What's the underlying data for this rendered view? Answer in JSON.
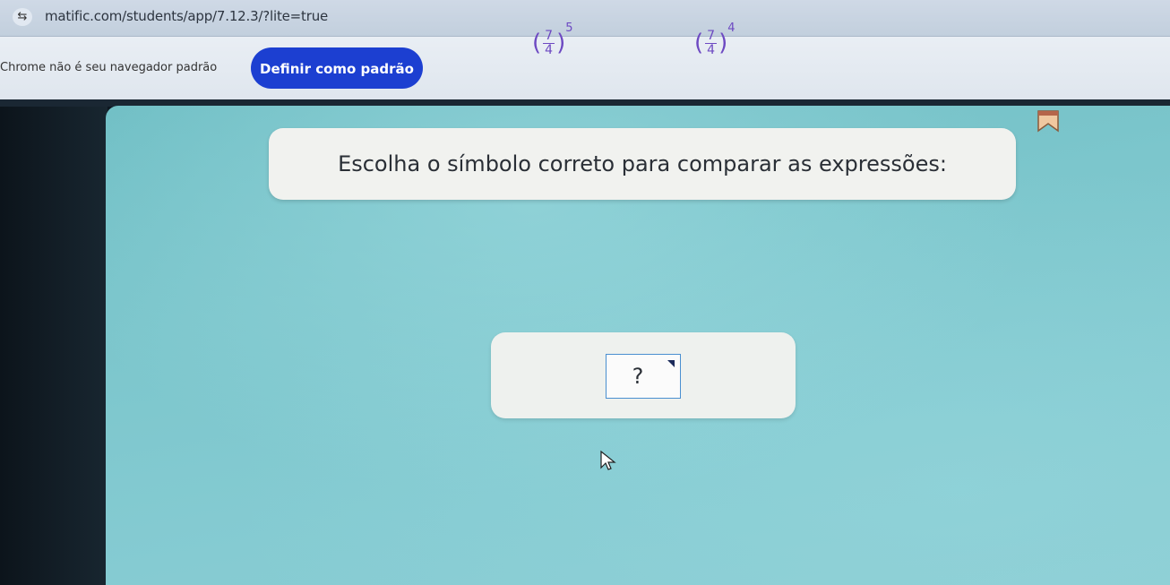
{
  "browser": {
    "url": "matific.com/students/app/7.12.3/?lite=true",
    "site_icon": "tune-icon"
  },
  "infobar": {
    "message": "Chrome não é seu navegador padrão",
    "button_label": "Definir como padrão",
    "button_color": "#1c3fd1"
  },
  "game": {
    "prompt": "Escolha o símbolo correto para comparar as expressões:",
    "left_expression": {
      "numerator": "7",
      "denominator": "4",
      "exponent": "5"
    },
    "symbol_placeholder": "?",
    "right_expression": {
      "numerator": "7",
      "denominator": "4",
      "exponent": "4"
    },
    "expression_color": "#6d49c2",
    "icons": [
      "bookmark-icon",
      "mouse-cursor-icon",
      "dropdown-caret-icon"
    ]
  }
}
